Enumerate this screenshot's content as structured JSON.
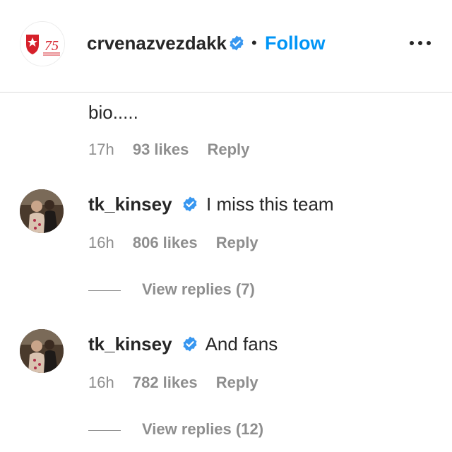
{
  "header": {
    "username": "crvenazvezdakk",
    "separator": "•",
    "follow_label": "Follow",
    "logo_number": "75",
    "accent_color": "#0095f6",
    "verified_color": "#3897f0",
    "logo_color": "#d6202a"
  },
  "comments": [
    {
      "partial_text": "bio.....",
      "time": "17h",
      "likes": "93 likes",
      "reply_label": "Reply"
    },
    {
      "author": "tk_kinsey",
      "text": "I miss this team",
      "time": "16h",
      "likes": "806 likes",
      "reply_label": "Reply",
      "view_replies": "View replies (7)"
    },
    {
      "author": "tk_kinsey",
      "text": "And fans",
      "time": "16h",
      "likes": "782 likes",
      "reply_label": "Reply",
      "view_replies": "View replies (12)"
    }
  ]
}
